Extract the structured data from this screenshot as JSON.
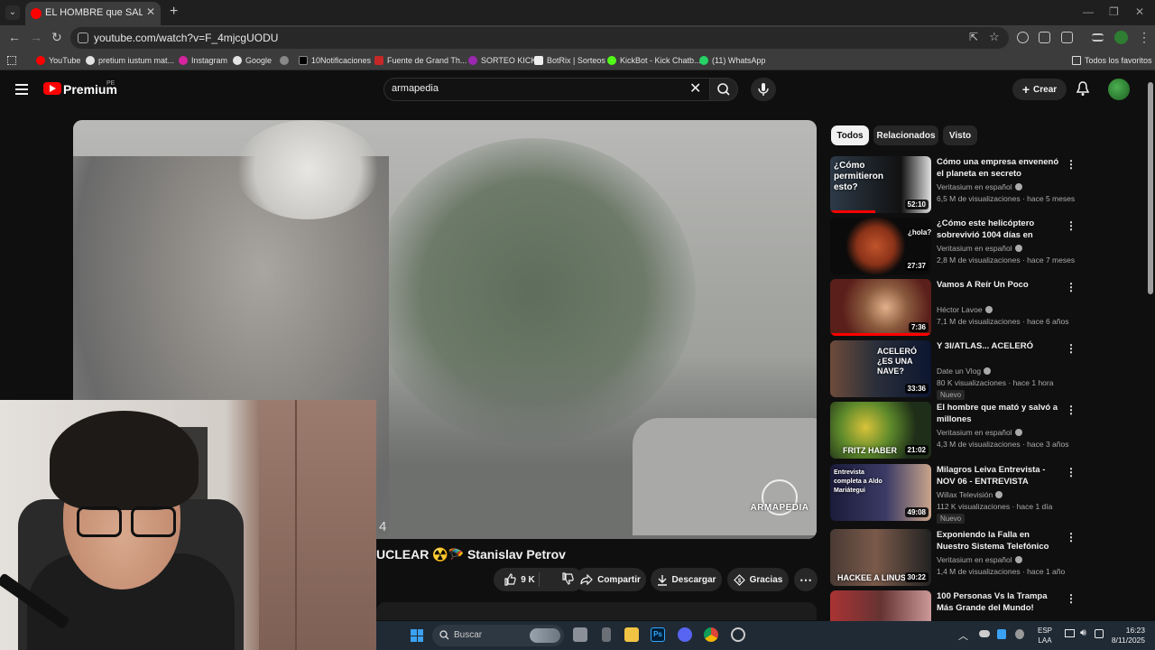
{
  "browser": {
    "tab_title": "EL HOMBRE que SALVÓ al M",
    "url": "youtube.com/watch?v=F_4mjcgUODU",
    "bookmarks": [
      "YouTube",
      "pretium iustum mat...",
      "Instagram",
      "Google",
      "10Notificaciones",
      "Fuente de Grand Th...",
      "SORTEO KICK",
      "BotRix | Sorteos",
      "KickBot - Kick Chatb...",
      "(11) WhatsApp"
    ],
    "all_bookmarks": "Todos los favoritos"
  },
  "youtube": {
    "brand": "Premium",
    "country": "PE",
    "search_value": "armapedia",
    "create_label": "Crear"
  },
  "video": {
    "watermark": "ARMAPEDIA",
    "time_fragment": "4",
    "title": "UCLEAR ☢️🪂 Stanislav Petrov",
    "like_count": "9 K",
    "share_label": "Compartir",
    "download_label": "Descargar",
    "thanks_label": "Gracias"
  },
  "sidebar": {
    "chips": [
      "Todos",
      "Relacionados",
      "Visto"
    ],
    "recommendations": [
      {
        "title": "Cómo una empresa envenenó el planeta en secreto",
        "channel": "Veritasium en español",
        "meta": "6,5 M de visualizaciones · hace 5 meses",
        "duration": "52:10",
        "thumb_text": "¿Cómo permitieron esto?",
        "badge": "",
        "progress": 0.45
      },
      {
        "title": "¿Cómo este helicóptero sobrevivió 1004 días en Marte...",
        "channel": "Veritasium en español",
        "meta": "2,8 M de visualizaciones · hace 7 meses",
        "duration": "27:37",
        "thumb_text": "¿hola?",
        "badge": "",
        "progress": 0
      },
      {
        "title": "Vamos A Reír Un Poco",
        "channel": "Héctor Lavoe",
        "meta": "7,1 M de visualizaciones · hace 6 años",
        "duration": "7:36",
        "thumb_text": "",
        "badge": "",
        "progress": 1.0
      },
      {
        "title": "Y 3I/ATLAS... ACELERÓ",
        "channel": "Date un Vlog",
        "meta": "80 K visualizaciones · hace 1 hora",
        "duration": "33:36",
        "thumb_text": "ACELERÓ ¿ES UNA NAVE?",
        "badge": "Nuevo",
        "progress": 0
      },
      {
        "title": "El hombre que mató y salvó a millones",
        "channel": "Veritasium en español",
        "meta": "4,3 M de visualizaciones · hace 3 años",
        "duration": "21:02",
        "thumb_text": "FRITZ HABER",
        "badge": "",
        "progress": 0
      },
      {
        "title": "Milagros Leiva Entrevista - NOV 06 - ENTREVISTA COMPLETA ...",
        "channel": "Willax Televisión",
        "meta": "112 K visualizaciones · hace 1 día",
        "duration": "49:08",
        "thumb_text": "Entrevista completa a Aldo Mariátegui",
        "badge": "Nuevo",
        "progress": 0
      },
      {
        "title": "Exponiendo la Falla en Nuestro Sistema Telefónico",
        "channel": "Veritasium en español",
        "meta": "1,4 M de visualizaciones · hace 1 año",
        "duration": "30:22",
        "thumb_text": "HACKEE A LINUS",
        "badge": "",
        "progress": 0
      },
      {
        "title": "100 Personas Vs la Trampa Más Grande del Mundo!",
        "channel": "",
        "meta": "",
        "duration": "",
        "thumb_text": "",
        "badge": "",
        "progress": 0
      }
    ]
  },
  "taskbar": {
    "search_placeholder": "Buscar",
    "lang_line1": "ESP",
    "lang_line2": "LAA",
    "time": "16:23",
    "date": "8/11/2025"
  },
  "colors": {
    "yt_red": "#ff0000",
    "bg": "#0f0f0f",
    "chip_active_bg": "#f1f1f1"
  }
}
